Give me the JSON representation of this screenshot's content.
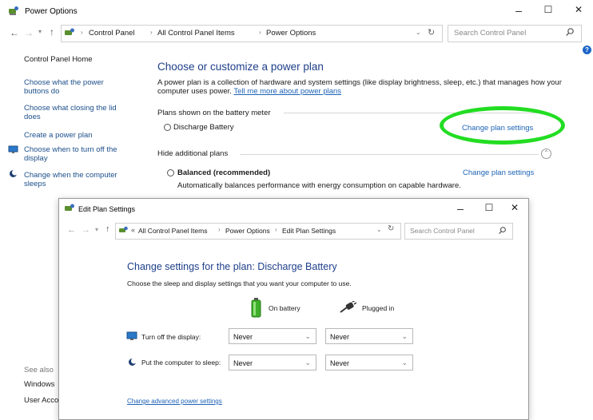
{
  "main": {
    "title": "Power Options",
    "controls": {
      "minimize": "–",
      "maximize": "☐",
      "close": "✕"
    },
    "address": {
      "segments": [
        "Control Panel",
        "All Control Panel Items",
        "Power Options"
      ]
    },
    "search": {
      "placeholder": "Search Control Panel"
    },
    "sidebar": {
      "home": "Control Panel Home",
      "links": [
        "Choose what the power buttons do",
        "Choose what closing the lid does",
        "Create a power plan",
        "Choose when to turn off the display",
        "Change when the computer sleeps"
      ],
      "see_also": "See also",
      "see_also_items": [
        "Windows",
        "User Acco"
      ]
    },
    "content": {
      "heading": "Choose or customize a power plan",
      "intro": "A power plan is a collection of hardware and system settings (like display brightness, sleep, etc.) that manages how your computer uses power.",
      "intro_link": "Tell me more about power plans",
      "battery_meter_label": "Plans shown on the battery meter",
      "plan1": {
        "name": "Discharge Battery",
        "link": "Change plan settings"
      },
      "hide_label": "Hide additional plans",
      "plan2": {
        "name": "Balanced (recommended)",
        "link": "Change plan settings",
        "desc": "Automatically balances performance with energy consumption on capable hardware."
      }
    }
  },
  "dialog": {
    "title": "Edit Plan Settings",
    "controls": {
      "minimize": "–",
      "maximize": "☐",
      "close": "✕"
    },
    "address": {
      "prefix": "«",
      "segments": [
        "All Control Panel Items",
        "Power Options",
        "Edit Plan Settings"
      ]
    },
    "search": {
      "placeholder": "Search Control Panel"
    },
    "heading": "Change settings for the plan: Discharge Battery",
    "subtitle": "Choose the sleep and display settings that you want your computer to use.",
    "col_battery": "On battery",
    "col_plugged": "Plugged in",
    "rows": [
      {
        "label": "Turn off the display:",
        "battery": "Never",
        "plugged": "Never"
      },
      {
        "label": "Put the computer to sleep:",
        "battery": "Never",
        "plugged": "Never"
      }
    ],
    "advanced_link": "Change advanced power settings"
  },
  "annotation": {
    "color": "#22dd22"
  }
}
